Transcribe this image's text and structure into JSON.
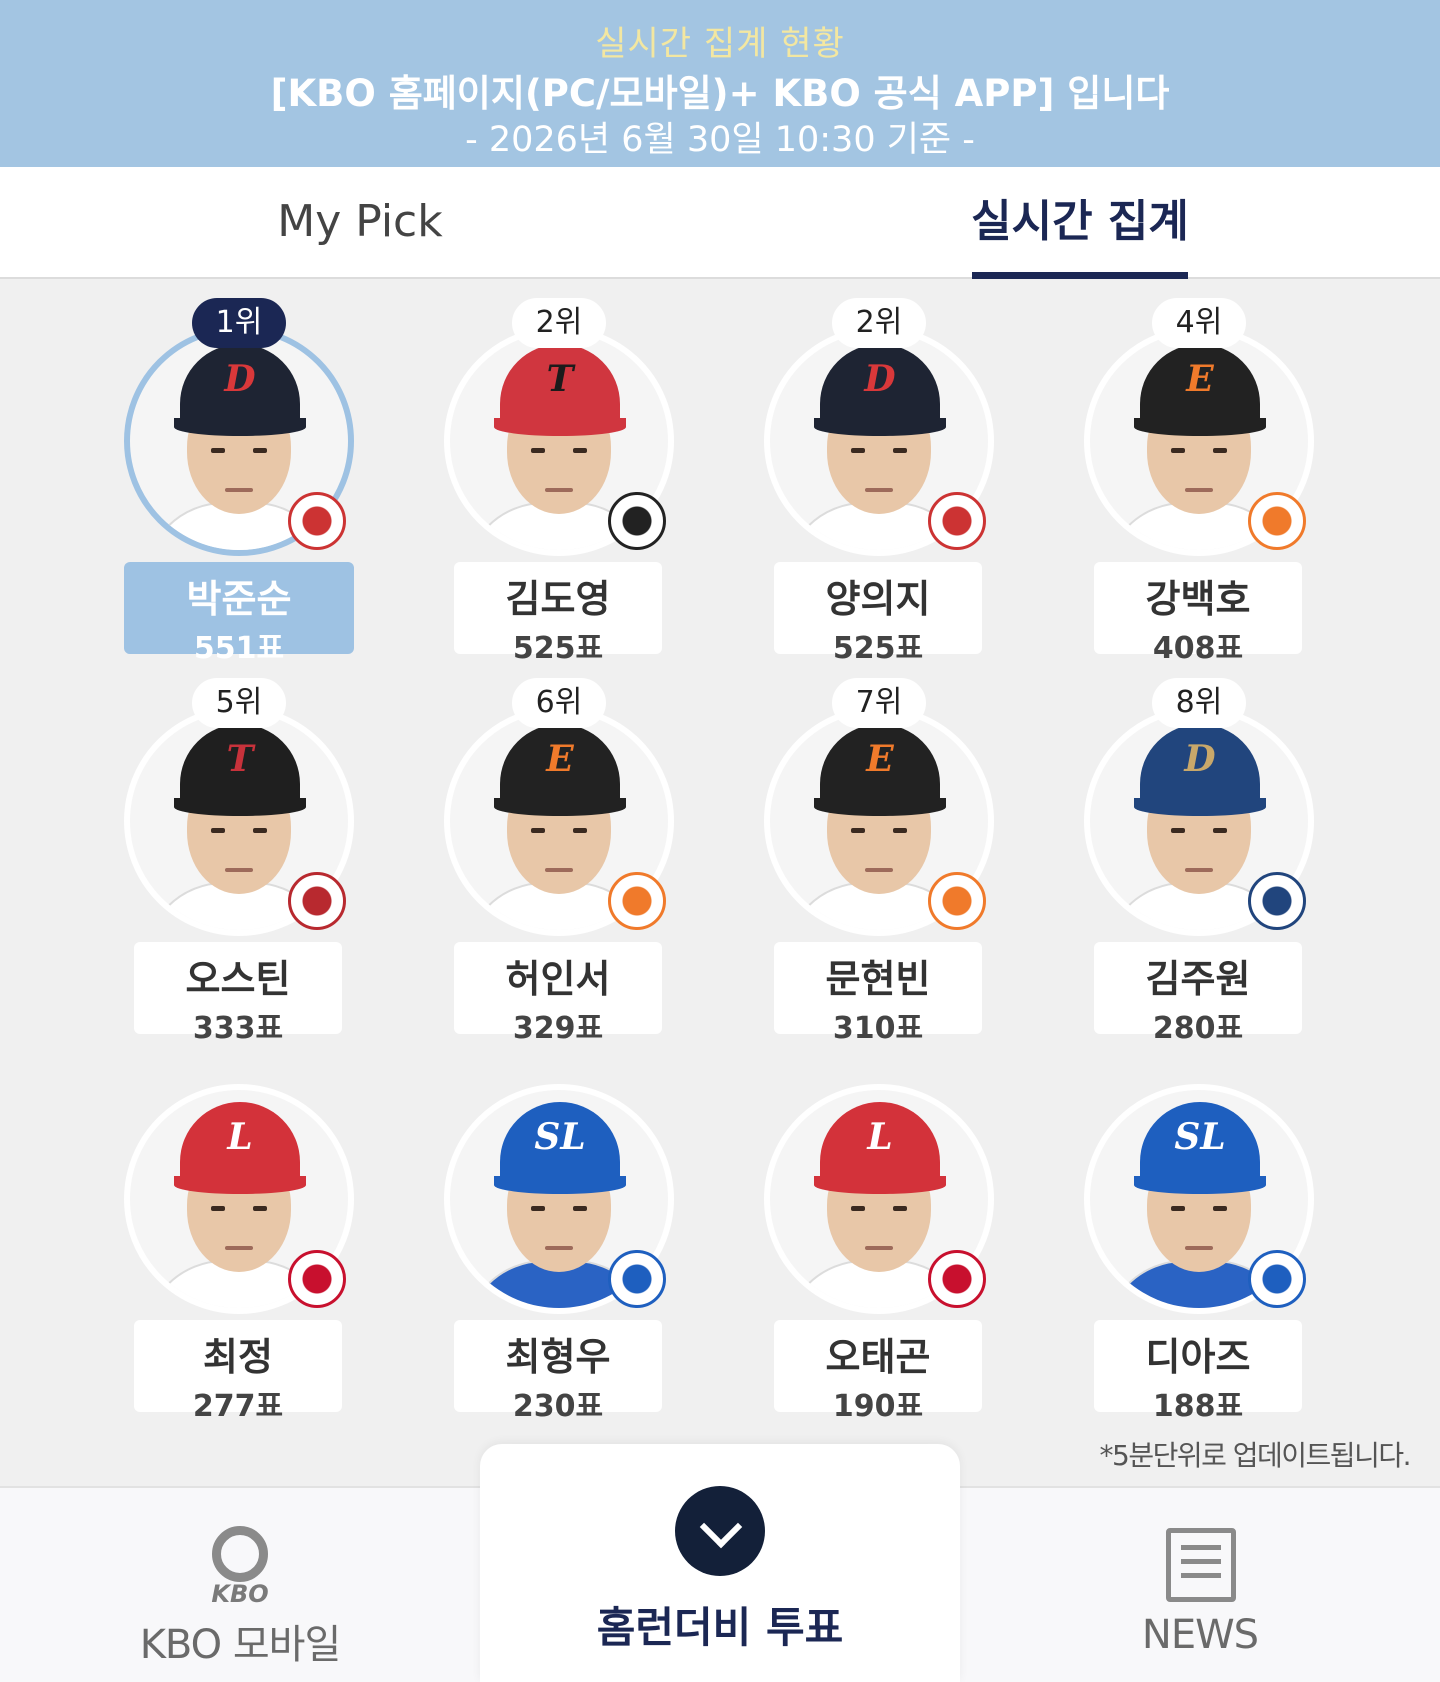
{
  "banner": {
    "line1": "실시간 집계 현황",
    "line2": "[KBO 홈페이지(PC/모바일)+ KBO 공식 APP] 입니다",
    "line3": "- 2026년 6월 30일 10:30 기준 -"
  },
  "tabs": {
    "mypick": "My Pick",
    "live": "실시간 집계"
  },
  "players": [
    {
      "rank": "1위",
      "name": "박준순",
      "votes": "551표",
      "team": "Bears",
      "cap": "#1e2433",
      "letter": "D",
      "letter_color": "#d9383a"
    },
    {
      "rank": "2위",
      "name": "김도영",
      "votes": "525표",
      "team": "Tigers",
      "cap": "#d0363f",
      "letter": "T",
      "letter_color": "#1b1b1b"
    },
    {
      "rank": "2위",
      "name": "양의지",
      "votes": "525표",
      "team": "Bears",
      "cap": "#1e2433",
      "letter": "D",
      "letter_color": "#d9383a"
    },
    {
      "rank": "4위",
      "name": "강백호",
      "votes": "408표",
      "team": "Eagles",
      "cap": "#222222",
      "letter": "E",
      "letter_color": "#f07a2b"
    },
    {
      "rank": "5위",
      "name": "오스틴",
      "votes": "333표",
      "team": "Twins",
      "cap": "#1f1f1f",
      "letter": "T",
      "letter_color": "#c8323b"
    },
    {
      "rank": "6위",
      "name": "허인서",
      "votes": "329표",
      "team": "Eagles",
      "cap": "#222222",
      "letter": "E",
      "letter_color": "#f07a2b"
    },
    {
      "rank": "7위",
      "name": "문현빈",
      "votes": "310표",
      "team": "Eagles",
      "cap": "#222222",
      "letter": "E",
      "letter_color": "#f07a2b"
    },
    {
      "rank": "8위",
      "name": "김주원",
      "votes": "280표",
      "team": "Dinos",
      "cap": "#21457d",
      "letter": "D",
      "letter_color": "#c9a86a"
    },
    {
      "rank": "",
      "name": "최정",
      "votes": "277표",
      "team": "Landers",
      "cap": "#d3323a",
      "letter": "L",
      "letter_color": "#ffffff"
    },
    {
      "rank": "",
      "name": "최형우",
      "votes": "230표",
      "team": "Lions",
      "cap": "#1e5fbf",
      "letter": "SL",
      "letter_color": "#ffffff"
    },
    {
      "rank": "",
      "name": "오태곤",
      "votes": "190표",
      "team": "Landers",
      "cap": "#d3323a",
      "letter": "L",
      "letter_color": "#ffffff"
    },
    {
      "rank": "",
      "name": "디아즈",
      "votes": "188표",
      "team": "Lions",
      "cap": "#1e5fbf",
      "letter": "SL",
      "letter_color": "#ffffff"
    }
  ],
  "note": "*5분단위로 업데이트됩니다.",
  "bottom_nav": {
    "kbo_mark": "KBO",
    "kbo_label": "KBO 모바일",
    "vote_label": "홈런더비 투표",
    "news_label": "NEWS"
  },
  "colors": {
    "banner_bg": "#a3c5e2",
    "accent_navy": "#1b2754",
    "highlight_blue": "#9ec2e3"
  }
}
